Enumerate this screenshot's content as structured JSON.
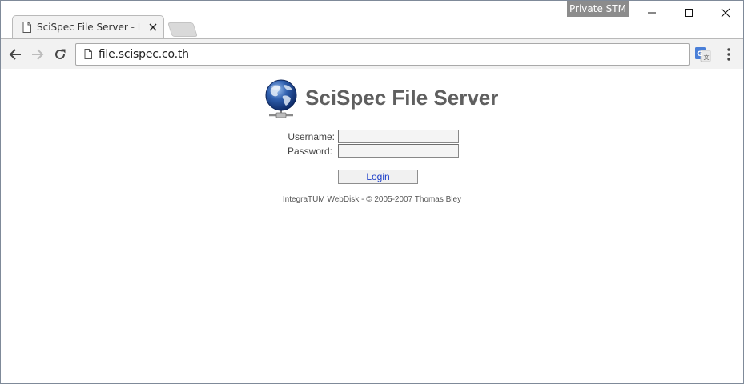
{
  "browser": {
    "profile_badge": "Private STM",
    "tab": {
      "title": "SciSpec File Server - Login"
    },
    "address_bar": {
      "url": "file.scispec.co.th"
    }
  },
  "page": {
    "site_title": "SciSpec File Server",
    "form": {
      "username_label": "Username:",
      "password_label": "Password:",
      "username_value": "",
      "password_value": "",
      "login_label": "Login"
    },
    "footer": "IntegraTUM WebDisk - © 2005-2007 Thomas Bley"
  },
  "icons": {
    "tab_favicon": "page-icon",
    "tab_close": "close-icon",
    "back": "arrow-left-icon",
    "forward": "arrow-right-icon",
    "reload": "reload-icon",
    "omnibox_page": "page-icon",
    "translate": "google-translate-icon",
    "menu": "kebab-menu-icon",
    "logo": "network-globe-icon"
  },
  "colors": {
    "profile_badge_bg": "#8c8c8c",
    "title_text": "#5f5f5f",
    "login_text": "#1a3cc8",
    "translate_blue": "#4a7fd8"
  }
}
